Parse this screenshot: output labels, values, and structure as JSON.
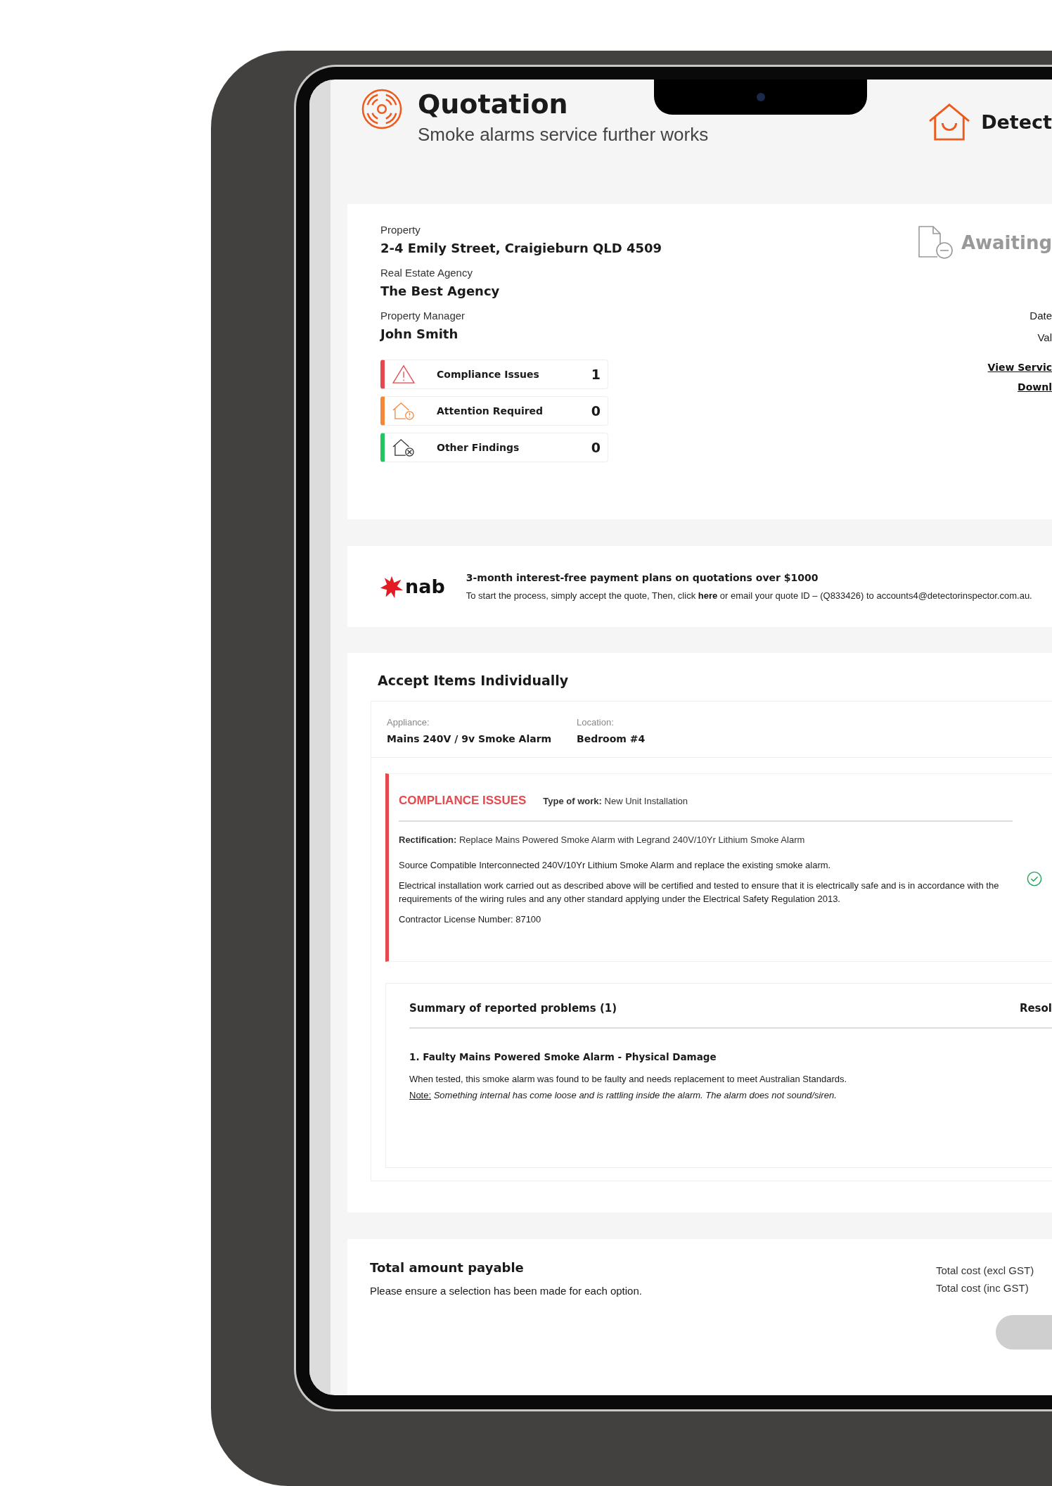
{
  "header": {
    "title": "Quotation",
    "subtitle": "Smoke alarms service further works",
    "brand": "Detect"
  },
  "property": {
    "fields": [
      {
        "label": "Property",
        "value": "2-4 Emily Street, Craigieburn QLD 4509"
      },
      {
        "label": "Real Estate Agency",
        "value": "The Best Agency"
      },
      {
        "label": "Property Manager",
        "value": "John Smith"
      }
    ],
    "findings": [
      {
        "kind": "compliance",
        "label": "Compliance Issues",
        "count": "1",
        "color": "#e5484d"
      },
      {
        "kind": "attention",
        "label": "Attention Required",
        "count": "0",
        "color": "#f4873a"
      },
      {
        "kind": "other",
        "label": "Other Findings",
        "count": "0",
        "color": "#22c55e"
      }
    ],
    "status": {
      "label": "Awaiting"
    },
    "details": [
      "Date",
      "Val"
    ],
    "links": [
      "View Servic",
      "Downl"
    ]
  },
  "finance": {
    "logo": "nab",
    "headline": "3-month interest-free payment plans on quotations over $1000",
    "text_before": "To start the process, simply accept the quote, Then, click",
    "link": "here",
    "text_after": "or email your quote ID – (Q833426) to accounts4@detectorinspector.com.au."
  },
  "items_section": {
    "title": "Accept Items Individually",
    "items": [
      {
        "appliance_label": "Appliance:",
        "appliance": "Mains 240V / 9v Smoke Alarm",
        "location_label": "Location:",
        "location": "Bedroom #4",
        "issue": {
          "kind": "compliance",
          "category": "COMPLIANCE ISSUES",
          "type_of_work": "**Type of work:** New Unit Installation",
          "rectification": "**Rectification:** Replace Mains Powered Smoke Alarm with Legrand 240V/10Yr Lithium Smoke Alarm",
          "paragraphs": [
            "Source Compatible Interconnected 240V/10Yr Lithium Smoke Alarm and replace the existing smoke alarm.",
            "Electrical installation work carried out as described above will be certified and tested to ensure that it is electrically safe and is in accordance with the requirements of the wiring rules and any other standard applying under the Electrical Safety Regulation 2013.",
            "Contractor License Number: 87100"
          ],
          "accepted": true
        },
        "summary": {
          "title": "Summary of reported problems (1)",
          "column_2": "Resol",
          "problems": [
            {
              "title": "1. Faulty Mains Powered Smoke Alarm - Physical Damage",
              "text": "When tested, this smoke alarm was found to be faulty and needs replacement to meet Australian Standards.",
              "note_label": "Note:",
              "note": "Something internal has come loose and is rattling inside the alarm. The alarm does not sound/siren."
            }
          ]
        }
      }
    ]
  },
  "totals": {
    "title": "Total amount payable",
    "hint": "Please ensure a selection has been made for each option.",
    "cost_labels": [
      "Total cost (excl GST)",
      "Total cost (inc GST)"
    ]
  }
}
